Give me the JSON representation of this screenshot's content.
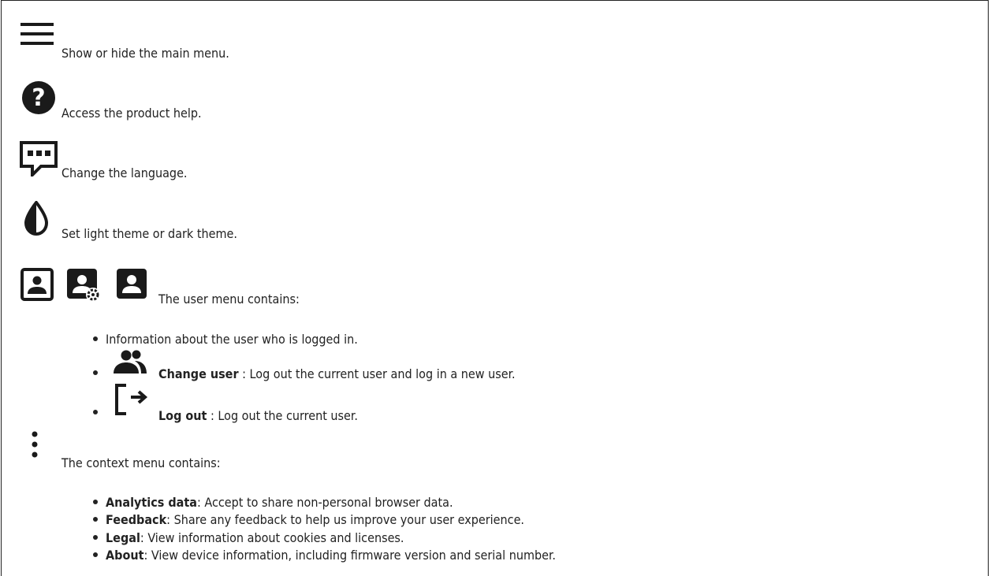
{
  "items": {
    "menu": {
      "text": "Show or hide the main menu."
    },
    "help": {
      "text": "Access the product help."
    },
    "language": {
      "text": "Change the language."
    },
    "theme": {
      "text": "Set light theme or dark theme."
    },
    "user": {
      "text": "The user menu contains:",
      "bullets": [
        {
          "text": "Information about the user who is logged in."
        },
        {
          "label": "Change user",
          "text": " : Log out the current user and log in a new user."
        },
        {
          "label": "Log out",
          "text": " : Log out the current user."
        }
      ]
    },
    "context": {
      "text": "The context menu contains:",
      "bullets": [
        {
          "label": "Analytics data",
          "text": ": Accept to share non-personal browser data."
        },
        {
          "label": "Feedback",
          "text": ": Share any feedback to help us improve your user experience."
        },
        {
          "label": "Legal",
          "text": ": View information about cookies and licenses."
        },
        {
          "label": "About",
          "text": ": View device information, including firmware version and serial number."
        }
      ]
    }
  }
}
